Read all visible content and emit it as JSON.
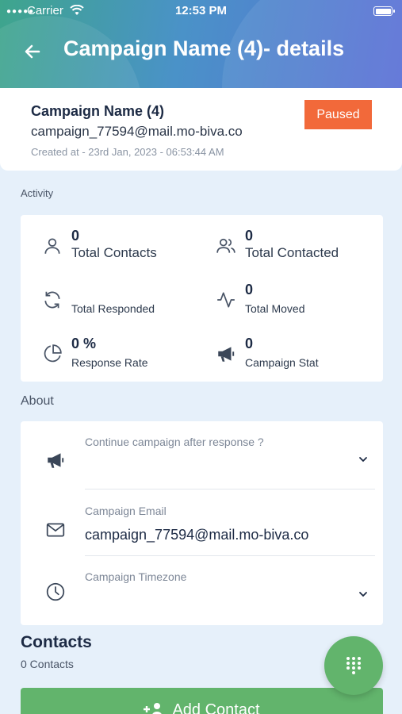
{
  "status_bar": {
    "carrier": "Carrier",
    "time": "12:53 PM"
  },
  "header": {
    "title": "Campaign Name (4)- details",
    "back_icon": "arrow-left-icon"
  },
  "summary": {
    "name": "Campaign Name (4)",
    "email": "campaign_77594@mail.mo-biva.co",
    "created": "Created at - 23rd Jan, 2023 - 06:53:44 AM",
    "status": "Paused",
    "status_color": "#f2693a"
  },
  "activity": {
    "section_label": "Activity",
    "stats": [
      {
        "icon": "user-icon",
        "value": "0",
        "label": "Total Contacts"
      },
      {
        "icon": "users-icon",
        "value": "0",
        "label": "Total Contacted"
      },
      {
        "icon": "refresh-icon",
        "value": "",
        "label": "Total Responded"
      },
      {
        "icon": "activity-icon",
        "value": "0",
        "label": "Total Moved"
      },
      {
        "icon": "pie-chart-icon",
        "value": "0 %",
        "label": "Response Rate"
      },
      {
        "icon": "megaphone-icon",
        "value": "0",
        "label": "Campaign Stat"
      }
    ]
  },
  "about": {
    "section_label": "About",
    "continue_after_response": {
      "label": "Continue campaign after response ?",
      "value": ""
    },
    "campaign_email": {
      "label": "Campaign Email",
      "value": "campaign_77594@mail.mo-biva.co"
    },
    "campaign_timezone": {
      "label": "Campaign Timezone",
      "value": ""
    }
  },
  "contacts": {
    "title": "Contacts",
    "count": "0 Contacts",
    "add_label": "Add Contact"
  },
  "colors": {
    "accent_green": "#62b46c",
    "background": "#e6f0fa"
  }
}
